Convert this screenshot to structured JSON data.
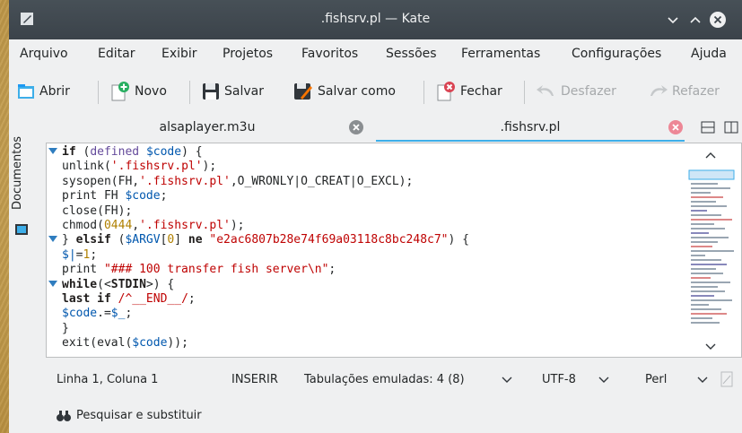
{
  "window": {
    "title": ".fishsrv.pl — Kate"
  },
  "menu": [
    "Arquivo",
    "Editar",
    "Exibir",
    "Projetos",
    "Favoritos",
    "Sessões",
    "Ferramentas",
    "Configurações",
    "Ajuda"
  ],
  "toolbar": {
    "open": "Abrir",
    "new": "Novo",
    "save": "Salvar",
    "save_as": "Salvar como",
    "close": "Fechar",
    "undo": "Desfazer",
    "redo": "Refazer"
  },
  "sidebar": {
    "documents": "Documentos"
  },
  "tabs": [
    {
      "label": "alsaplayer.m3u",
      "active": false
    },
    {
      "label": ".fishsrv.pl",
      "active": true
    }
  ],
  "code": {
    "l1": [
      "if",
      " (",
      "defined",
      " ",
      "$code",
      ") {"
    ],
    "l2": [
      "unlink(",
      "'.fishsrv.pl'",
      ");"
    ],
    "l3": [
      "sysopen(FH,",
      "'.fishsrv.pl'",
      ",O_WRONLY|O_CREAT|O_EXCL);"
    ],
    "l4": [
      "print FH ",
      "$code",
      ";"
    ],
    "l5": [
      "close(FH);"
    ],
    "l6": [
      "chmod(",
      "0444",
      ",",
      "'.fishsrv.pl'",
      ");"
    ],
    "l7": [
      "} ",
      "elsif",
      " (",
      "$ARGV",
      "[",
      "0",
      "] ",
      "ne",
      " ",
      "\"e2ac6807b28e74f69a03118c8bc248c7\"",
      ") {"
    ],
    "l8": [
      "$|",
      "=",
      "1",
      ";"
    ],
    "l9": [
      "print ",
      "\"### 100 transfer fish server\\n\"",
      ";"
    ],
    "l10": [
      "while",
      "(<",
      "STDIN",
      ">) {"
    ],
    "l11": [
      "last if",
      " ",
      "/^__END__/",
      ";"
    ],
    "l12": [
      "$code",
      ".=",
      "$_",
      ";"
    ],
    "l13": [
      "}"
    ],
    "l14": [
      "exit(eval(",
      "$code",
      "));"
    ]
  },
  "statusbar": {
    "position": "Linha 1, Coluna 1",
    "mode": "INSERIR",
    "indent": "Tabulações emuladas: 4 (8)",
    "encoding": "UTF-8",
    "syntax": "Perl"
  },
  "search": {
    "label": "Pesquisar e substituir"
  },
  "colors": {
    "accent": "#3daee9",
    "titlebar": "#475057",
    "close_red": "#da4453"
  }
}
